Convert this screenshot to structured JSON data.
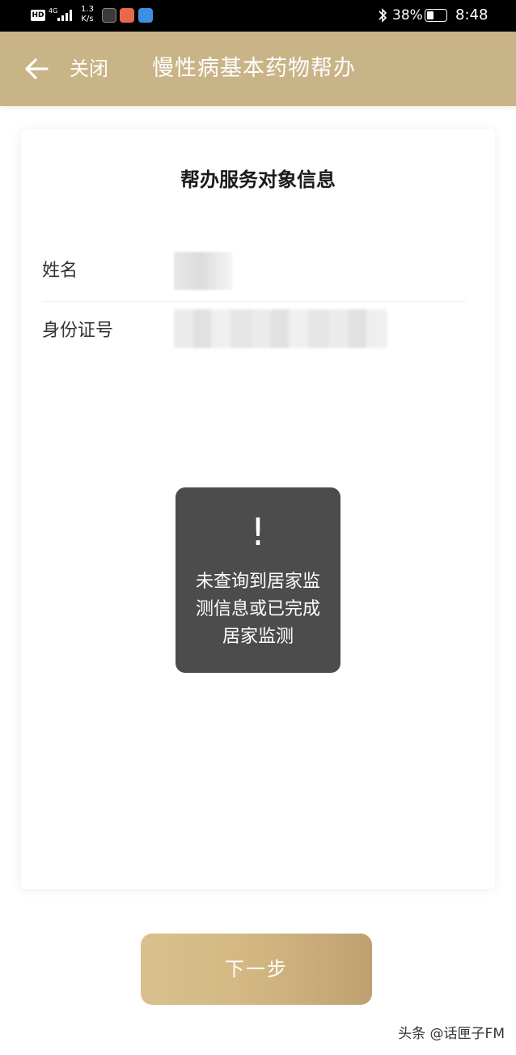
{
  "status_bar": {
    "hd": "HD",
    "network": "4G",
    "speed_value": "1.3",
    "speed_unit": "K/s",
    "battery_percent": "38%",
    "battery_level": 0.38,
    "time": "8:48"
  },
  "nav": {
    "close_label": "关闭",
    "title": "慢性病基本药物帮办"
  },
  "card": {
    "title": "帮办服务对象信息",
    "fields": [
      {
        "label": "姓名",
        "value": ""
      },
      {
        "label": "身份证号",
        "value": ""
      }
    ]
  },
  "toast": {
    "icon": "exclamation-icon",
    "icon_glyph": "!",
    "message": "未查询到居家监测信息或已完成居家监测"
  },
  "next_button": {
    "label": "下一步"
  },
  "watermark": "头条 @话匣子FM",
  "colors": {
    "nav_background": "#c9b487",
    "toast_background": "#4c4c4c",
    "button_start": "#d9c08c",
    "button_end": "#bfa171"
  }
}
